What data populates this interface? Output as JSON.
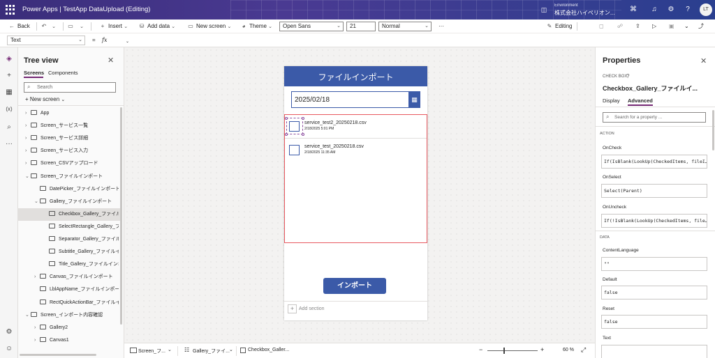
{
  "header": {
    "app_title": "Power Apps  |  TestApp DataUpload (Editing)",
    "environment_label": "Environment",
    "environment_name": "株式会社ハイペリオン...",
    "avatar_initials": "LT"
  },
  "toolbar": {
    "back": "Back",
    "insert": "Insert",
    "add_data": "Add data",
    "new_screen": "New screen",
    "theme": "Theme",
    "font": "Open Sans",
    "font_size": "21",
    "font_weight": "Normal",
    "more": "···",
    "editing": "Editing"
  },
  "formula_bar": {
    "property": "Text",
    "equals": "=",
    "fx": "fx"
  },
  "tree": {
    "title": "Tree view",
    "tabs": [
      "Screens",
      "Components"
    ],
    "search_placeholder": "Search",
    "new_screen": "New screen",
    "items": [
      {
        "label": "App",
        "indent": 0,
        "chev": "›"
      },
      {
        "label": "Screen_サービス一覧",
        "indent": 0,
        "chev": "›"
      },
      {
        "label": "Screen_サービス詳細",
        "indent": 0,
        "chev": "›"
      },
      {
        "label": "Screen_サービス入力",
        "indent": 0,
        "chev": "›"
      },
      {
        "label": "Screen_CSVアップロード",
        "indent": 0,
        "chev": "›"
      },
      {
        "label": "Screen_ファイルインポート",
        "indent": 0,
        "chev": "⌄"
      },
      {
        "label": "DatePicker_ファイルインポート",
        "indent": 1,
        "chev": ""
      },
      {
        "label": "Gallery_ファイルインポート",
        "indent": 1,
        "chev": "⌄"
      },
      {
        "label": "Checkbox_Gallery_ファイルイ",
        "indent": 2,
        "chev": "",
        "selected": true
      },
      {
        "label": "SelectRectangle_Gallery_ファ",
        "indent": 2,
        "chev": ""
      },
      {
        "label": "Separator_Gallery_ファイルイ",
        "indent": 2,
        "chev": ""
      },
      {
        "label": "Subtitle_Gallery_ファイルイン",
        "indent": 2,
        "chev": ""
      },
      {
        "label": "Title_Gallery_ファイルインポ",
        "indent": 2,
        "chev": ""
      },
      {
        "label": "Canvas_ファイルインポート",
        "indent": 1,
        "chev": "›"
      },
      {
        "label": "LblAppName_ファイルインポート",
        "indent": 1,
        "chev": ""
      },
      {
        "label": "RectQuickActionBar_ファイルイン",
        "indent": 1,
        "chev": ""
      },
      {
        "label": "Screen_インポート内容確認",
        "indent": 0,
        "chev": "⌄"
      },
      {
        "label": "Gallery2",
        "indent": 1,
        "chev": "›"
      },
      {
        "label": "Canvas1",
        "indent": 1,
        "chev": "›"
      }
    ]
  },
  "screen": {
    "title": "ファイルインポート",
    "date": "2025/02/18",
    "gallery": [
      {
        "title": "service_test2_20250218.csv",
        "subtitle": "2/18/2025 5:01 PM"
      },
      {
        "title": "service_test_20250218.csv",
        "subtitle": "2/18/2025 11:35 AM"
      }
    ],
    "import_button": "インポート",
    "add_section": "Add section"
  },
  "status_bar": {
    "crumbs": [
      "Screen_フ...",
      "Gallery_ファイ...",
      "Checkbox_Galler..."
    ],
    "zoom": "60",
    "zoom_unit": "%"
  },
  "properties": {
    "title": "Properties",
    "type": "CHECK BOX",
    "name": "Checkbox_Gallery_ファイルイ...",
    "tabs": [
      "Display",
      "Advanced"
    ],
    "search_placeholder": "Search for a property ...",
    "sections": {
      "action": "ACTION",
      "data": "DATA"
    },
    "fields": [
      {
        "label": "OnCheck",
        "value": "If(IsBlank(LookUp(CheckedItems, fileI…"
      },
      {
        "label": "OnSelect",
        "value": "Select(Parent)"
      },
      {
        "label": "OnUncheck",
        "value": "If(!IsBlank(LookUp(CheckedItems, file…"
      },
      {
        "label": "ContentLanguage",
        "value": "\"\""
      },
      {
        "label": "Default",
        "value": "false"
      },
      {
        "label": "Reset",
        "value": "false"
      },
      {
        "label": "Text",
        "value": ""
      }
    ]
  },
  "colors": {
    "accent": "#742774",
    "screen_header": "#3b5aa8",
    "selection": "#e8585f",
    "titlebar": "#3a2d7a"
  }
}
